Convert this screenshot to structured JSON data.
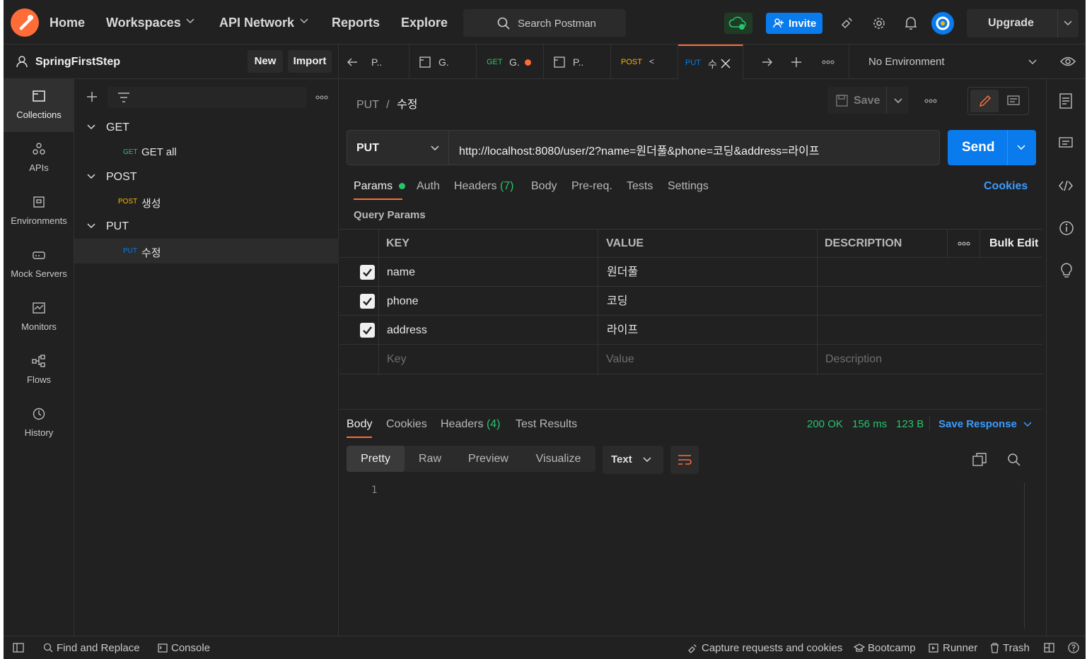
{
  "topbar": {
    "nav": [
      "Home",
      "Workspaces",
      "API Network",
      "Reports",
      "Explore"
    ],
    "search_placeholder": "Search Postman",
    "invite_label": "Invite",
    "upgrade_label": "Upgrade"
  },
  "workspace": {
    "name": "SpringFirstStep",
    "new_label": "New",
    "import_label": "Import"
  },
  "rail": [
    "Collections",
    "APIs",
    "Environments",
    "Mock Servers",
    "Monitors",
    "Flows",
    "History"
  ],
  "tree": {
    "folders": [
      {
        "name": "GET",
        "requests": [
          {
            "method": "GET",
            "name": "GET all"
          }
        ]
      },
      {
        "name": "POST",
        "requests": [
          {
            "method": "POST",
            "name": "생성"
          }
        ]
      },
      {
        "name": "PUT",
        "requests": [
          {
            "method": "PUT",
            "name": "수정"
          }
        ]
      }
    ]
  },
  "tabs": [
    {
      "label": "P..",
      "method": ""
    },
    {
      "label": "G.",
      "method": ""
    },
    {
      "label": "G.",
      "method": "GET"
    },
    {
      "label": "P..",
      "method": ""
    },
    {
      "label": "<",
      "method": "POST"
    },
    {
      "label": "수",
      "method": "PUT"
    }
  ],
  "environment": "No Environment",
  "request": {
    "crumb_method": "PUT",
    "crumb_sep": "/",
    "crumb_name": "수정",
    "save_label": "Save",
    "method": "PUT",
    "url": "http://localhost:8080/user/2?name=원더풀&phone=코딩&address=라이프",
    "send_label": "Send"
  },
  "request_tabs": {
    "params": "Params",
    "auth": "Auth",
    "headers": "Headers",
    "headers_count": "(7)",
    "body": "Body",
    "prereq": "Pre-req.",
    "tests": "Tests",
    "settings": "Settings",
    "cookies": "Cookies"
  },
  "query_params": {
    "title": "Query Params",
    "headers": {
      "key": "KEY",
      "value": "VALUE",
      "description": "DESCRIPTION",
      "bulk_edit": "Bulk Edit"
    },
    "rows": [
      {
        "key": "name",
        "value": "원더풀"
      },
      {
        "key": "phone",
        "value": "코딩"
      },
      {
        "key": "address",
        "value": "라이프"
      }
    ],
    "placeholders": {
      "key": "Key",
      "value": "Value",
      "description": "Description"
    }
  },
  "response": {
    "tabs": {
      "body": "Body",
      "cookies": "Cookies",
      "headers": "Headers",
      "headers_count": "(4)",
      "tests": "Test Results"
    },
    "status": "200 OK",
    "time": "156 ms",
    "size": "123 B",
    "save_response": "Save Response",
    "formats": [
      "Pretty",
      "Raw",
      "Preview",
      "Visualize"
    ],
    "type": "Text",
    "line_number": "1"
  },
  "statusbar": {
    "find_replace": "Find and Replace",
    "console": "Console",
    "capture": "Capture requests and cookies",
    "bootcamp": "Bootcamp",
    "runner": "Runner",
    "trash": "Trash"
  },
  "colors": {
    "accent": "#ff6c37",
    "blue": "#097bed",
    "green": "#27c46b",
    "put": "#097bed",
    "post": "#ffb400",
    "get": "#27c46b"
  }
}
